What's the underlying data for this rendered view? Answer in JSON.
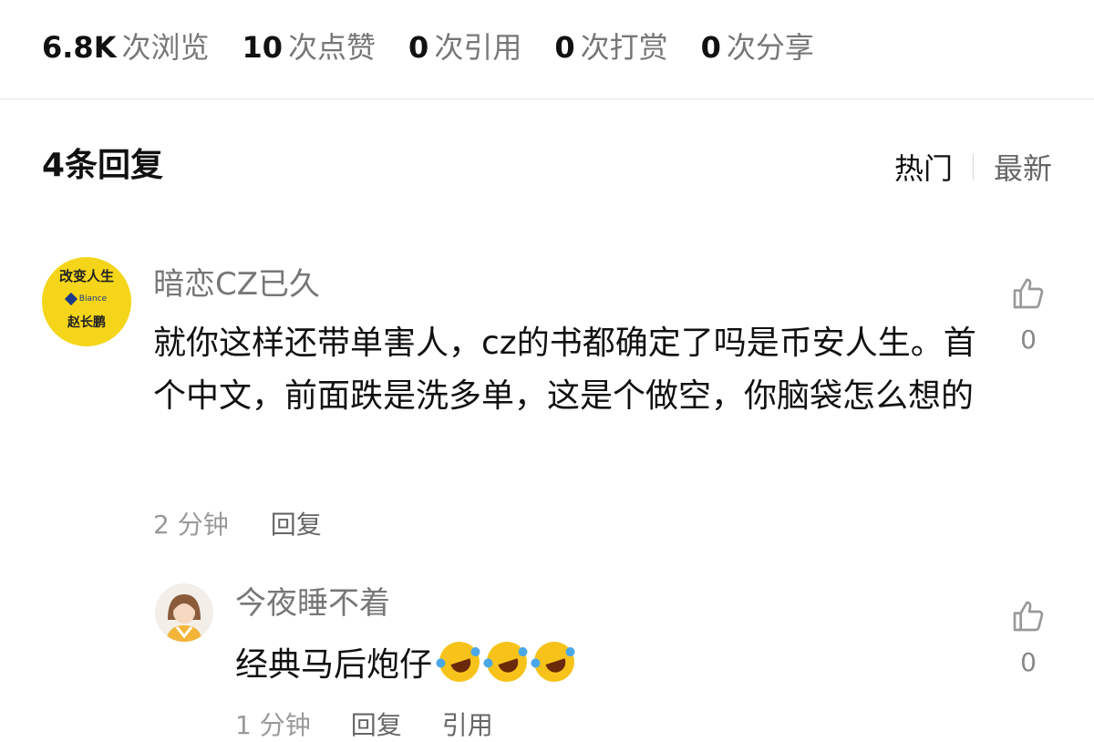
{
  "stats": [
    {
      "num": "6.8K",
      "label": "次浏览"
    },
    {
      "num": "10",
      "label": "次点赞"
    },
    {
      "num": "0",
      "label": "次引用"
    },
    {
      "num": "0",
      "label": "次打赏"
    },
    {
      "num": "0",
      "label": "次分享"
    }
  ],
  "replies_header": {
    "count_label": "4条回复",
    "sort_hot": "热门",
    "sort_new": "最新"
  },
  "comment1": {
    "avatar_text_top": "改变人生",
    "avatar_brand": "Biance",
    "avatar_text_bottom": "赵长鹏",
    "username": "暗恋CZ已久",
    "body": "就你这样还带单害人，cz的书都确定了吗是币安人生。首个中文，前面跌是洗多单，这是个做空，你脑袋怎么想的",
    "time": "2 分钟",
    "reply_label": "回复",
    "likes": "0"
  },
  "comment2": {
    "username": "今夜睡不着",
    "body": "经典马后炮仔",
    "emoji_name": "rolling-on-floor-laughing",
    "time": "1 分钟",
    "reply_label": "回复",
    "quote_label": "引用",
    "likes": "0"
  },
  "colors": {
    "avatar_yellow": "#f4d51a",
    "text_primary": "#111111",
    "text_secondary": "#777777"
  }
}
